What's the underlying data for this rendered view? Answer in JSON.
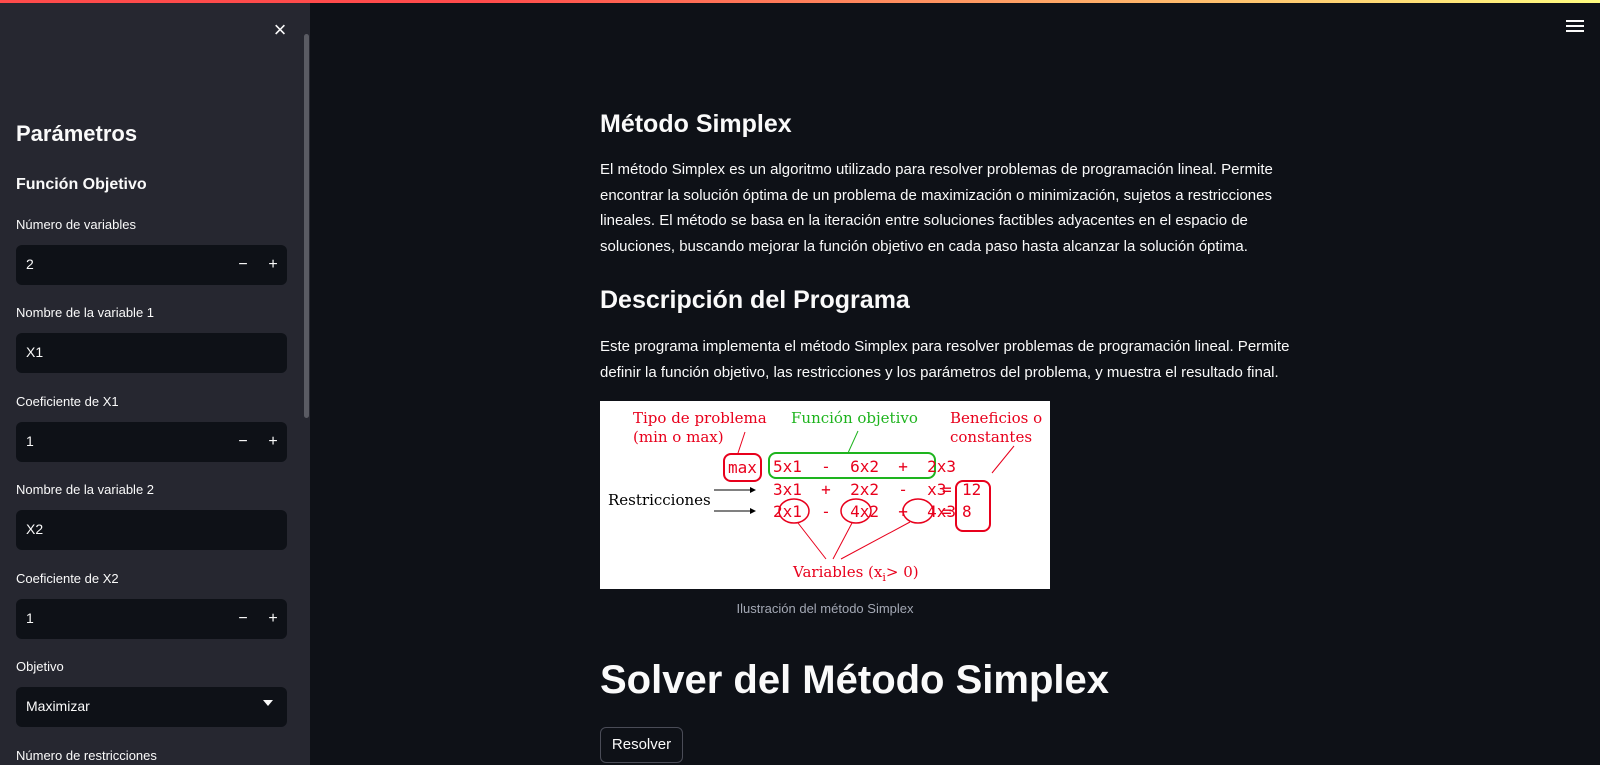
{
  "sidebar": {
    "close_icon": "×",
    "title": "Parámetros",
    "subtitle": "Función Objetivo",
    "fields": {
      "num_vars": {
        "label": "Número de variables",
        "value": "2",
        "minus": "−",
        "plus": "+"
      },
      "var1_name": {
        "label": "Nombre de la variable 1",
        "value": "X1"
      },
      "coef1": {
        "label": "Coeficiente de X1",
        "value": "1",
        "minus": "−",
        "plus": "+"
      },
      "var2_name": {
        "label": "Nombre de la variable 2",
        "value": "X2"
      },
      "coef2": {
        "label": "Coeficiente de X2",
        "value": "1",
        "minus": "−",
        "plus": "+"
      },
      "objective": {
        "label": "Objetivo",
        "value": "Maximizar"
      },
      "num_constraints": {
        "label": "Número de restricciones"
      }
    }
  },
  "main": {
    "section1": {
      "title": "Método Simplex",
      "text": "El método Simplex es un algoritmo utilizado para resolver problemas de programación lineal. Permite encontrar la solución óptima de un problema de maximización o minimización, sujetos a restricciones lineales. El método se basa en la iteración entre soluciones factibles adyacentes en el espacio de soluciones, buscando mejorar la función objetivo en cada paso hasta alcanzar la solución óptima."
    },
    "section2": {
      "title": "Descripción del Programa",
      "text": "Este programa implementa el método Simplex para resolver problemas de programación lineal. Permite definir la función objetivo, las restricciones y los parámetros del problema, y muestra el resultado final."
    },
    "figure": {
      "label_tipo_1": "Tipo de problema",
      "label_tipo_2": "(min o max)",
      "label_funcion": "Función objetivo",
      "label_benef_1": "Beneficios o",
      "label_benef_2": "constantes",
      "label_restr": "Restricciones",
      "max": "max",
      "objective_expr": "5x1  -  6x2  +  2x3",
      "row1": "3x1  +  2x2  -  x3",
      "row2": "2x1  -  4x2  +  4x3",
      "eq1": "=",
      "eq2": "=",
      "rhs1": "12",
      "rhs2": "8",
      "label_vars": "Variables (x",
      "label_vars_sub": "i",
      "label_vars_end": "> 0)",
      "caption": "Ilustración del método Simplex"
    },
    "solver_title": "Solver del Método Simplex",
    "resolve_button": "Resolver"
  },
  "colors": {
    "background": "#0e1117",
    "sidebar": "#262730",
    "accent_red": "#ff4b4b",
    "figure_red": "#e8001c",
    "figure_green": "#1eb41e"
  }
}
